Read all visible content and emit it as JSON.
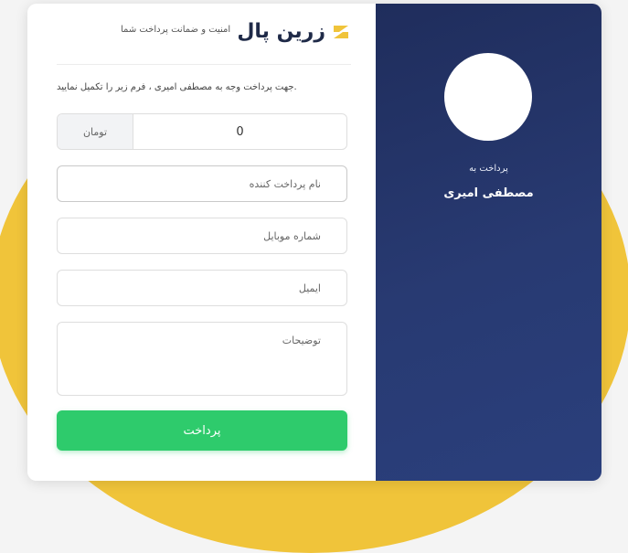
{
  "brand": {
    "logo_text": "زرین پال",
    "accent_color": "#f0c43a",
    "security_text": "امنیت و ضمانت پرداخت شما"
  },
  "form": {
    "instruction": ".جهت پرداخت وجه به مصطفی امیری ، فرم زیر را تکمیل نمایید",
    "amount": {
      "value": "0",
      "currency": "تومان"
    },
    "payer_name_placeholder": "نام پرداخت کننده",
    "mobile_placeholder": "شماره موبایل",
    "email_placeholder": "ایمیل",
    "description_placeholder": "توضیحات",
    "submit_label": "پرداخت",
    "submit_color": "#2ecb6c"
  },
  "recipient": {
    "pay_to_label": "پرداخت به",
    "name": "مصطفی امیری"
  }
}
